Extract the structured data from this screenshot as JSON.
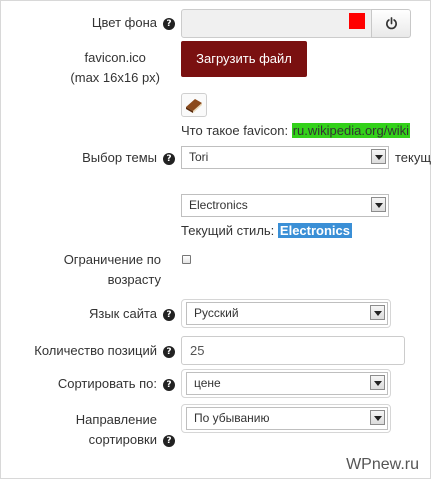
{
  "fields": {
    "bg_color": {
      "label": "Цвет фона"
    },
    "favicon": {
      "label_line1": "favicon.ico",
      "label_line2": "(max 16x16 px)",
      "upload_label": "Загрузить файл",
      "info_prefix": "Что такое favicon:",
      "info_link": "ru.wikipedia.org/wiki"
    },
    "theme": {
      "label": "Выбор темы",
      "selected": "Tori",
      "trailing": "текущ"
    },
    "style": {
      "selected": "Electronics",
      "current_prefix": "Текущий стиль:",
      "current_value": "Electronics"
    },
    "age": {
      "label_line1": "Ограничение по",
      "label_line2": "возрасту",
      "checked": false
    },
    "language": {
      "label": "Язык сайта",
      "selected": "Русский"
    },
    "count": {
      "label": "Количество позиций",
      "value": "25"
    },
    "sort": {
      "label": "Сортировать по:",
      "selected": "цене"
    },
    "direction": {
      "label_line1": "Направление",
      "label_line2": "сортировки",
      "selected": "По убыванию"
    }
  },
  "icons": {
    "help": "question-circle-icon",
    "power": "power-icon",
    "favicon": "favicon-book-icon",
    "dropdown": "chevron-down-icon"
  },
  "colors": {
    "swatch": "#ff0000",
    "upload_button": "#7a1010",
    "link_highlight": "#33d11a",
    "style_highlight": "#3a8fd6"
  },
  "watermark": "WPnew.ru"
}
